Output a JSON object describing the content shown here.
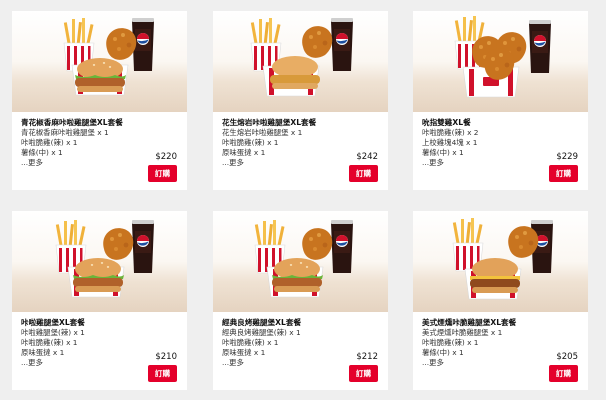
{
  "cards": [
    {
      "title": "青花椒香麻咔啦雞腿堡XL套餐",
      "lines": [
        "青花椒香麻咔啦雞腿堡 x 1",
        "咔啦脆雞(辣) x 1",
        "薯條(中) x 1"
      ],
      "more": "...更多",
      "price": "$220",
      "button": "訂購"
    },
    {
      "title": "花生熔岩咔啦雞腿堡XL套餐",
      "lines": [
        "花生熔岩咔啦雞腿堡 x 1",
        "咔啦脆雞(辣) x 1",
        "原味蛋撻 x 1"
      ],
      "more": "...更多",
      "price": "$242",
      "button": "訂購"
    },
    {
      "title": "吮指雙雞XL餐",
      "lines": [
        "咔啦脆雞(辣) x 2",
        "上校雞塊4塊 x 1",
        "薯條(中) x 1"
      ],
      "more": "...更多",
      "price": "$229",
      "button": "訂購"
    },
    {
      "title": "咔啦雞腿堡XL套餐",
      "lines": [
        "咔啦雞腿堡(辣) x 1",
        "咔啦脆雞(辣) x 1",
        "原味蛋撻 x 1"
      ],
      "more": "...更多",
      "price": "$210",
      "button": "訂購"
    },
    {
      "title": "經典良烤雞腿堡XL套餐",
      "lines": [
        "經典良烤雞腿堡(辣) x 1",
        "咔啦脆雞(辣) x 1",
        "原味蛋撻 x 1"
      ],
      "more": "...更多",
      "price": "$212",
      "button": "訂購"
    },
    {
      "title": "美式煙燻咔脆雞腿堡XL套餐",
      "lines": [
        "美式煙燻咔脆雞腿堡 x 1",
        "咔啦脆雞(辣) x 1",
        "薯條(中) x 1"
      ],
      "more": "...更多",
      "price": "$205",
      "button": "訂購"
    }
  ],
  "colors": {
    "accent": "#e4002b",
    "page_background": "#efefef",
    "card_background": "#ffffff"
  }
}
